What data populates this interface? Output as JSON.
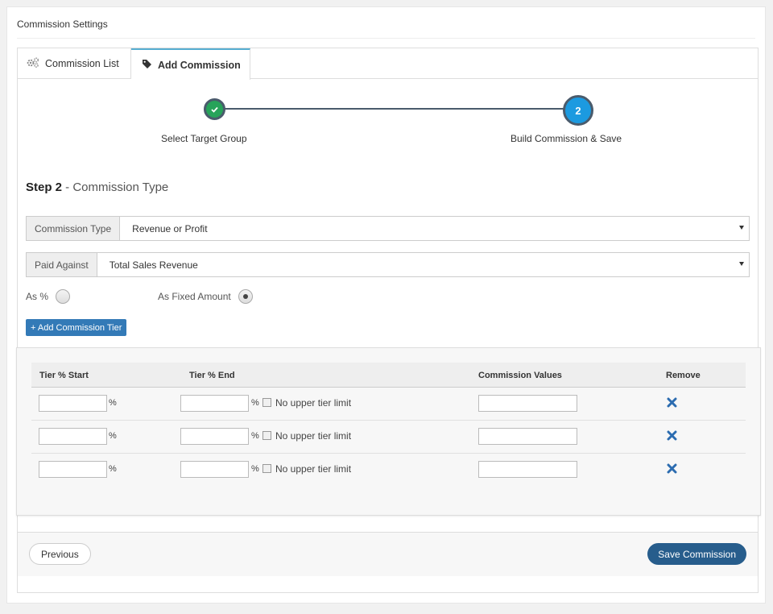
{
  "panel": {
    "title": "Commission Settings"
  },
  "tabs": [
    {
      "label": "Commission List",
      "icon": "gears-icon",
      "active": false
    },
    {
      "label": "Add Commission",
      "icon": "tag-icon",
      "active": true
    }
  ],
  "stepper": {
    "steps": [
      {
        "number": "1",
        "label": "Select Target Group",
        "status": "complete"
      },
      {
        "number": "2",
        "label": "Build Commission & Save",
        "status": "current"
      }
    ],
    "colors": {
      "complete": "#27a35a",
      "current": "#1c9ae0",
      "line": "#4a5b6c"
    }
  },
  "step_heading": {
    "prefix": "Step 2",
    "suffix": " - Commission Type"
  },
  "commission_type": {
    "label": "Commission Type",
    "value": "Revenue or Profit"
  },
  "paid_against": {
    "label": "Paid Against",
    "value": "Total Sales Revenue"
  },
  "mode": {
    "options": [
      {
        "label": "As %",
        "selected": false
      },
      {
        "label": "As Fixed Amount",
        "selected": true
      }
    ]
  },
  "add_tier_button": "+ Add Commission Tier",
  "tier_table": {
    "headers": {
      "start": "Tier % Start",
      "end": "Tier % End",
      "values": "Commission Values",
      "remove": "Remove"
    },
    "percent_sign": "%",
    "no_limit_label": "No upper tier limit",
    "rows": [
      {
        "start": "",
        "end": "",
        "no_limit": false,
        "value": ""
      },
      {
        "start": "",
        "end": "",
        "no_limit": false,
        "value": ""
      },
      {
        "start": "",
        "end": "",
        "no_limit": false,
        "value": ""
      }
    ]
  },
  "footer": {
    "previous": "Previous",
    "save": "Save Commission"
  },
  "accent": {
    "primary": "#337ab7",
    "save": "#275d8c",
    "remove": "#2c6cb0"
  }
}
